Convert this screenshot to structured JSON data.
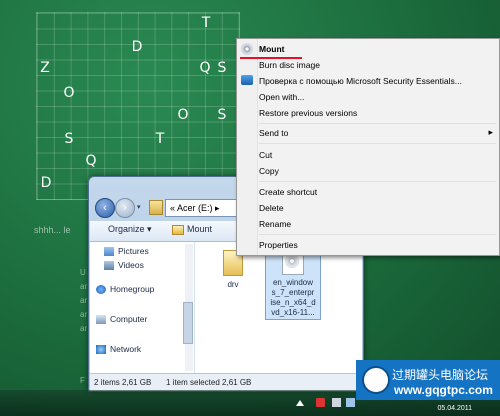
{
  "desktop": {
    "grid_letters": [
      "T",
      "D",
      "Z",
      "Q",
      "S",
      "O",
      "O",
      "S",
      "S",
      "T",
      "Q",
      "D"
    ],
    "caption": "shhh... le",
    "fragments": [
      "U",
      "ar",
      "ar",
      "ar",
      "ar",
      "F"
    ]
  },
  "window": {
    "address": "« Acer (E:) ▸",
    "toolbar": {
      "organize": "Organize ▾",
      "mount": "Mount"
    },
    "nav": {
      "items": [
        "Pictures",
        "Videos",
        "Homegroup",
        "Computer",
        "Network"
      ]
    },
    "files": [
      {
        "name": "drv"
      },
      {
        "name": "en_windows_7_enterprise_n_x64_dvd_x16-11..."
      }
    ],
    "file_lines": [
      "en_window",
      "s_7_enterpr",
      "ise_n_x64_d",
      "vd_x16-11..."
    ],
    "status": {
      "items": "2 items 2,61 GB",
      "selected": "1 item selected 2,61 GB"
    }
  },
  "context_menu": {
    "items": [
      {
        "label": "Mount",
        "bold": true
      },
      {
        "label": "Burn disc image"
      },
      {
        "label": "Проверка с помощью Microsoft Security Essentials..."
      },
      {
        "label": "Open with..."
      },
      {
        "label": "Restore previous versions"
      },
      {
        "label": "Send to"
      },
      {
        "label": "Cut"
      },
      {
        "label": "Copy"
      },
      {
        "label": "Create shortcut"
      },
      {
        "label": "Delete"
      },
      {
        "label": "Rename"
      },
      {
        "label": "Properties"
      }
    ],
    "submenu_arrow": "▸"
  },
  "taskbar": {
    "clock": "05.04.2011"
  },
  "watermark": {
    "title": "过期罐头电脑论坛",
    "url": "www.gqgtpc.com"
  },
  "colors": {
    "desktop": "#1e6b3e",
    "accent_red": "#e81123",
    "watermark": "#1573c3"
  }
}
